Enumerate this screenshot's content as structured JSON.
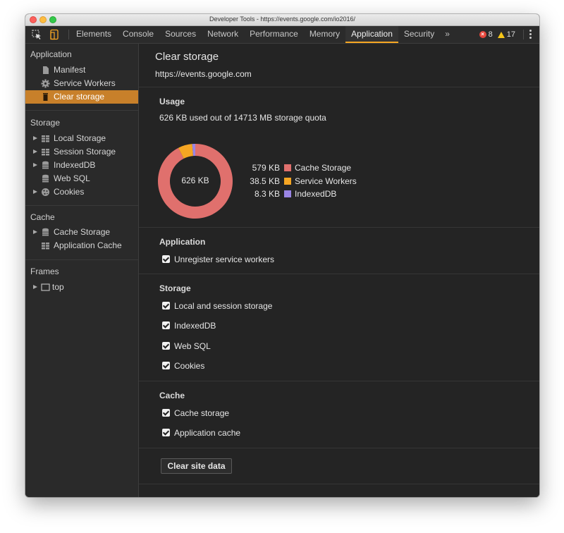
{
  "window": {
    "title": "Developer Tools - https://events.google.com/io2016/"
  },
  "toolbar": {
    "tabs": [
      {
        "label": "Elements"
      },
      {
        "label": "Console"
      },
      {
        "label": "Sources"
      },
      {
        "label": "Network"
      },
      {
        "label": "Performance"
      },
      {
        "label": "Memory"
      },
      {
        "label": "Application",
        "active": true
      },
      {
        "label": "Security"
      }
    ],
    "more_label": "»",
    "error_count": "8",
    "warning_count": "17"
  },
  "sidebar": {
    "application": {
      "heading": "Application",
      "items": [
        {
          "label": "Manifest",
          "icon": "file-icon"
        },
        {
          "label": "Service Workers",
          "icon": "gear-icon"
        },
        {
          "label": "Clear storage",
          "icon": "trash-icon",
          "selected": true
        }
      ]
    },
    "storage": {
      "heading": "Storage",
      "items": [
        {
          "label": "Local Storage",
          "icon": "grid-icon",
          "expandable": true
        },
        {
          "label": "Session Storage",
          "icon": "grid-icon",
          "expandable": true
        },
        {
          "label": "IndexedDB",
          "icon": "database-icon",
          "expandable": true
        },
        {
          "label": "Web SQL",
          "icon": "database-icon",
          "expandable": false
        },
        {
          "label": "Cookies",
          "icon": "cookie-icon",
          "expandable": true
        }
      ]
    },
    "cache": {
      "heading": "Cache",
      "items": [
        {
          "label": "Cache Storage",
          "icon": "database-icon",
          "expandable": true
        },
        {
          "label": "Application Cache",
          "icon": "grid-icon",
          "expandable": false
        }
      ]
    },
    "frames": {
      "heading": "Frames",
      "items": [
        {
          "label": "top",
          "icon": "frame-icon",
          "expandable": true
        }
      ]
    }
  },
  "main": {
    "title": "Clear storage",
    "origin": "https://events.google.com",
    "usage": {
      "heading": "Usage",
      "summary": "626 KB used out of 14713 MB storage quota",
      "total_label": "626 KB",
      "breakdown": [
        {
          "value_label": "579 KB",
          "name": "Cache Storage",
          "kb": 579,
          "color": "#e0706d"
        },
        {
          "value_label": "38.5 KB",
          "name": "Service Workers",
          "kb": 38.5,
          "color": "#f5a623"
        },
        {
          "value_label": "8.3 KB",
          "name": "IndexedDB",
          "kb": 8.3,
          "color": "#9a85e5"
        }
      ]
    },
    "application": {
      "heading": "Application",
      "options": [
        {
          "label": "Unregister service workers",
          "checked": true
        }
      ]
    },
    "storage": {
      "heading": "Storage",
      "options": [
        {
          "label": "Local and session storage",
          "checked": true
        },
        {
          "label": "IndexedDB",
          "checked": true
        },
        {
          "label": "Web SQL",
          "checked": true
        },
        {
          "label": "Cookies",
          "checked": true
        }
      ]
    },
    "cache": {
      "heading": "Cache",
      "options": [
        {
          "label": "Cache storage",
          "checked": true
        },
        {
          "label": "Application cache",
          "checked": true
        }
      ]
    },
    "clear_button_label": "Clear site data"
  }
}
